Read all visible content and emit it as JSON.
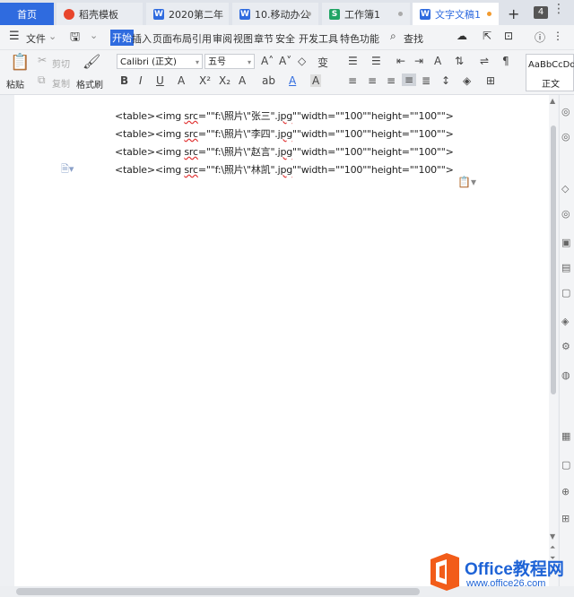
{
  "tabs": {
    "home": "首页",
    "items": [
      {
        "label": "稻壳模板",
        "icon": "daoke-icon"
      },
      {
        "label": "2020第二年",
        "icon": "word-doc-icon"
      },
      {
        "label": "10.移动办公",
        "icon": "word-doc-icon"
      },
      {
        "label": "工作簿1",
        "icon": "sheet-icon"
      },
      {
        "label": "文字文稿1",
        "icon": "word-doc-icon"
      }
    ],
    "new_tab": "+",
    "count": "4"
  },
  "menu": {
    "file": "文件",
    "items": [
      "开始",
      "插入",
      "页面布局",
      "引用",
      "审阅",
      "视图",
      "章节",
      "安全",
      "开发工具",
      "特色功能"
    ],
    "search": "查找"
  },
  "ribbon": {
    "paste": "粘贴",
    "cut": "剪切",
    "copy": "复制",
    "format_painter": "格式刷",
    "font_name": "Calibri (正文)",
    "font_size": "五号",
    "style_preview": "AaBbCcDd",
    "style_name": "正文"
  },
  "document": {
    "lines": [
      {
        "pre": "<table><img ",
        "sq1": "src",
        "mid": "=\"\"f:\\照片\\\"张三\".",
        "sq2": "jpg",
        "post": "\"\"width=\"\"100\"\"height=\"\"100\"\">"
      },
      {
        "pre": "<table><img ",
        "sq1": "src",
        "mid": "=\"\"f:\\照片\\\"李四\".",
        "sq2": "jpg",
        "post": "\"\"width=\"\"100\"\"height=\"\"100\"\">"
      },
      {
        "pre": "<table><img ",
        "sq1": "src",
        "mid": "=\"\"f:\\照片\\\"赵言\".",
        "sq2": "jpg",
        "post": "\"\"width=\"\"100\"\"height=\"\"100\"\">"
      },
      {
        "pre": "<table><img ",
        "sq1": "src",
        "mid": "=\"\"f:\\照片\\\"林凯\".",
        "sq2": "jpg",
        "post": "\"\"width=\"\"100\"\"height=\"\"100\"\">"
      }
    ]
  },
  "watermark": {
    "brand": "Office教程网",
    "url": "www.office26.com"
  },
  "colors": {
    "accent": "#2f6bdf",
    "tab_dot_active": "#f29a2e",
    "watermark": "#1e63d6",
    "logo_orange": "#f25c19"
  }
}
